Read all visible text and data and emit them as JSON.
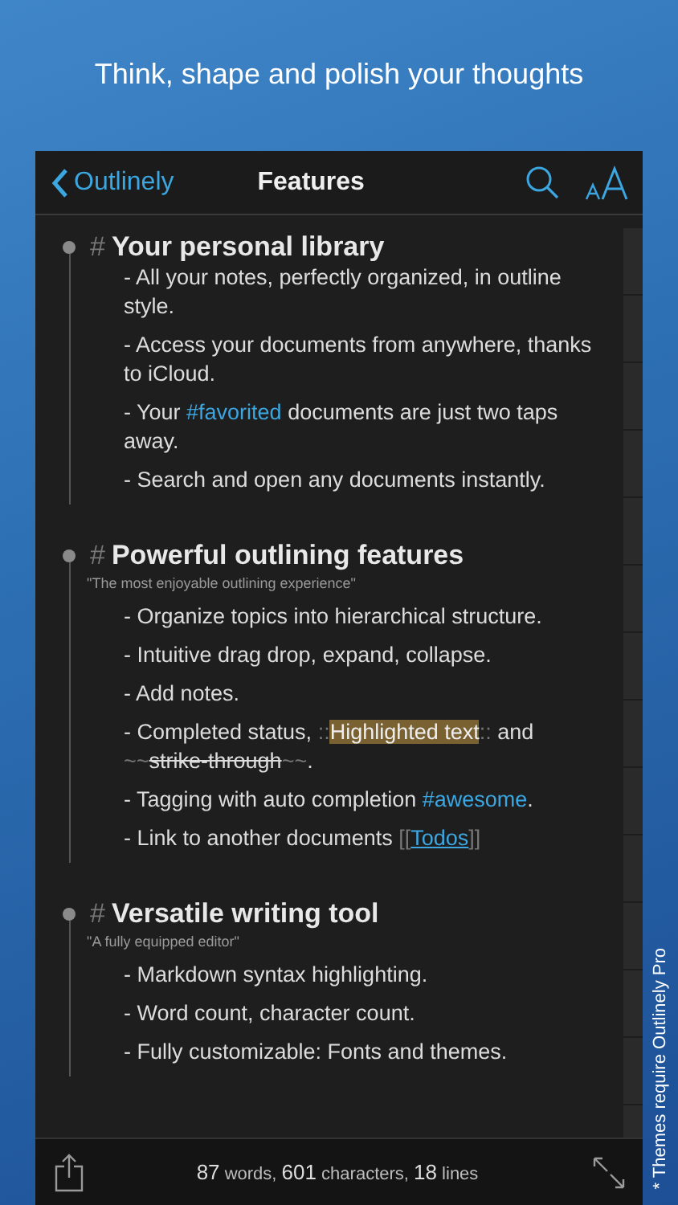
{
  "caption": "Think, shape and polish your thoughts",
  "side_note": "* Themes require Outlinely Pro",
  "navbar": {
    "back": "Outlinely",
    "title": "Features"
  },
  "sections": [
    {
      "marker": "#",
      "title": "Your personal library",
      "items": [
        [
          {
            "kind": "plain",
            "text": "- All your notes, perfectly organized, in outline style."
          }
        ],
        [
          {
            "kind": "plain",
            "text": "- Access your documents from anywhere, thanks to iCloud."
          }
        ],
        [
          {
            "kind": "plain",
            "text": "- Your "
          },
          {
            "kind": "tag",
            "text": "#favorited"
          },
          {
            "kind": "plain",
            "text": " documents are just two taps away."
          }
        ],
        [
          {
            "kind": "plain",
            "text": "- Search and open any documents instantly."
          }
        ]
      ]
    },
    {
      "marker": "#",
      "title": "Powerful outlining features",
      "note": "\"The most enjoyable outlining experience\"",
      "items": [
        [
          {
            "kind": "plain",
            "text": "- Organize topics into hierarchical structure."
          }
        ],
        [
          {
            "kind": "plain",
            "text": "- Intuitive drag drop, expand, collapse."
          }
        ],
        [
          {
            "kind": "plain",
            "text": "- Add notes."
          }
        ],
        [
          {
            "kind": "plain",
            "text": "- Completed status, "
          },
          {
            "kind": "syntax",
            "text": "::"
          },
          {
            "kind": "highlight",
            "text": "Highlighted text"
          },
          {
            "kind": "syntax",
            "text": "::"
          },
          {
            "kind": "plain",
            "text": " and "
          },
          {
            "kind": "syntax",
            "text": "~~"
          },
          {
            "kind": "strike",
            "text": "strike-through"
          },
          {
            "kind": "syntax",
            "text": "~~"
          },
          {
            "kind": "plain",
            "text": "."
          }
        ],
        [
          {
            "kind": "plain",
            "text": "- Tagging with auto completion "
          },
          {
            "kind": "tag",
            "text": "#awesome"
          },
          {
            "kind": "plain",
            "text": "."
          }
        ],
        [
          {
            "kind": "plain",
            "text": "- Link to another documents "
          },
          {
            "kind": "syntax",
            "text": "[["
          },
          {
            "kind": "link",
            "text": "Todos"
          },
          {
            "kind": "syntax",
            "text": "]]"
          }
        ]
      ]
    },
    {
      "marker": "#",
      "title": "Versatile writing tool",
      "note": "\"A fully equipped editor\"",
      "items": [
        [
          {
            "kind": "plain",
            "text": "- Markdown syntax highlighting."
          }
        ],
        [
          {
            "kind": "plain",
            "text": "- Word count, character count."
          }
        ],
        [
          {
            "kind": "plain",
            "text": "- Fully customizable: Fonts and themes."
          }
        ]
      ]
    }
  ],
  "status_bar": [
    {
      "kind": "number",
      "text": "87"
    },
    {
      "kind": "label",
      "text": " words, "
    },
    {
      "kind": "number",
      "text": "601"
    },
    {
      "kind": "label",
      "text": " characters, "
    },
    {
      "kind": "number",
      "text": "18"
    },
    {
      "kind": "label",
      "text": " lines"
    }
  ]
}
